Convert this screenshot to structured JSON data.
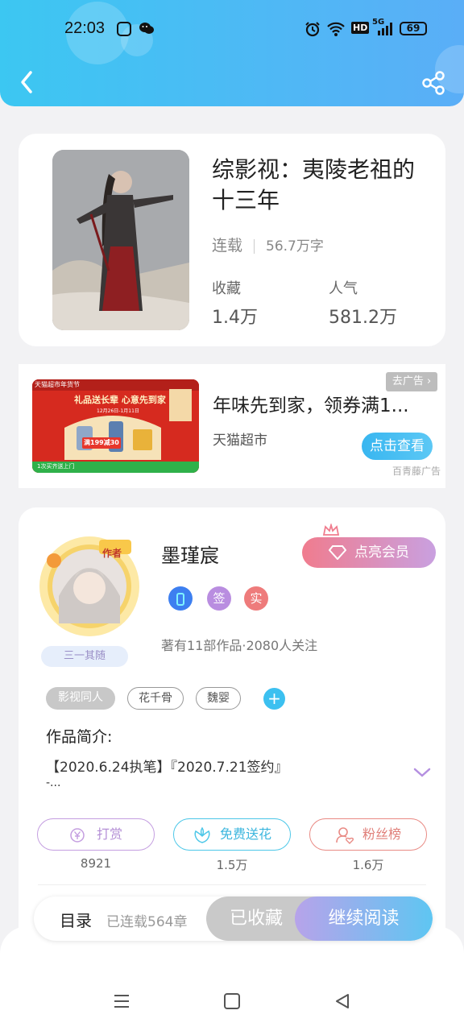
{
  "status_bar": {
    "time": "22:03",
    "battery": "69",
    "net": "5G",
    "hd": "HD"
  },
  "book": {
    "title": "综影视：夷陵老祖的十三年",
    "status": "连载",
    "words": "56.7万字",
    "favorites_label": "收藏",
    "favorites_value": "1.4万",
    "popularity_label": "人气",
    "popularity_value": "581.2万"
  },
  "ad": {
    "title": "年味先到家，领券满1...",
    "source": "天猫超市",
    "button": "点击查看",
    "close": "去广告",
    "mark": "百青藤广告",
    "banner_top": "天猫超市年货节",
    "banner_line": "礼品送长辈 心意先到家",
    "banner_date": "12月26日-1月11日",
    "banner_promo": "满199减30",
    "banner_bottom": "1次买齐送上门"
  },
  "author": {
    "name": "墨瑾宸",
    "vip_button": "点亮会员",
    "badge_sign": "签",
    "badge_real": "实",
    "info": "著有11部作品·2080人关注",
    "avatar_tag": "作者",
    "avatar_label": "三一其随"
  },
  "tags": [
    "影视同人",
    "花千骨",
    "魏婴"
  ],
  "intro": {
    "heading": "作品简介:",
    "line1": "【2020.6.24执笔】『2020.7.21签约』",
    "line2": "-..."
  },
  "actions": [
    {
      "label": "打赏",
      "count": "8921",
      "icon": "yen-coin-icon",
      "color": "#c49ee0"
    },
    {
      "label": "免费送花",
      "count": "1.5万",
      "icon": "flower-icon",
      "color": "#4cc7e8"
    },
    {
      "label": "粉丝榜",
      "count": "1.6万",
      "icon": "fan-user-icon",
      "color": "#e98a84"
    }
  ],
  "bottom_bar": {
    "toc": "目录",
    "chapters": "已连载564章",
    "collected": "已收藏",
    "continue": "继续阅读"
  },
  "colors": {
    "header": "#4fb8f5",
    "accent": "#38b6f0",
    "vip": "#f07c8e"
  }
}
